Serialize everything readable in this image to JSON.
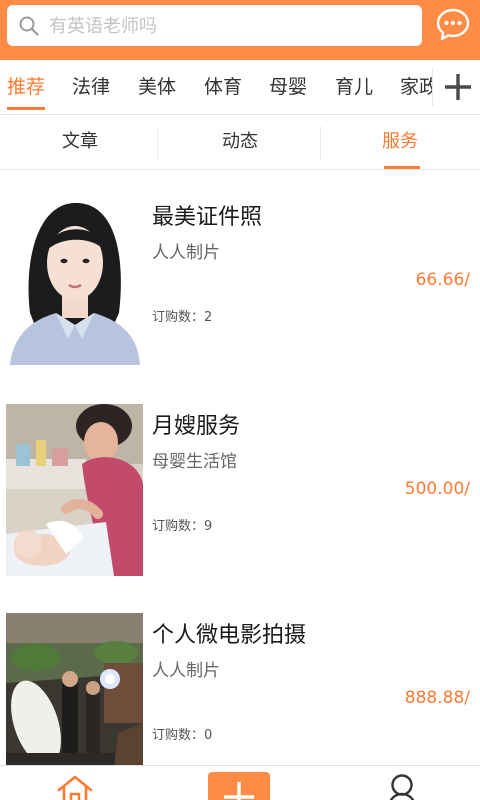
{
  "search": {
    "placeholder": "有英语老师吗"
  },
  "categories": [
    {
      "label": "推荐",
      "active": true
    },
    {
      "label": "法律",
      "active": false
    },
    {
      "label": "美体",
      "active": false
    },
    {
      "label": "体育",
      "active": false
    },
    {
      "label": "母婴",
      "active": false
    },
    {
      "label": "育儿",
      "active": false
    },
    {
      "label": "家政",
      "active": false
    }
  ],
  "sub_tabs": [
    {
      "label": "文章",
      "active": false
    },
    {
      "label": "动态",
      "active": false
    },
    {
      "label": "服务",
      "active": true
    }
  ],
  "services": [
    {
      "title": "最美证件照",
      "seller": "人人制片",
      "price": "66.66/",
      "orders": "订购数：2"
    },
    {
      "title": "月嫂服务",
      "seller": "母婴生活馆",
      "price": "500.00/",
      "orders": "订购数：9"
    },
    {
      "title": "个人微电影拍摄",
      "seller": "人人制片",
      "price": "888.88/",
      "orders": "订购数：0"
    }
  ],
  "colors": {
    "accent": "#ff7a33",
    "header": "#ff8c45"
  },
  "icons": {
    "search": "search-icon",
    "chat": "chat-bubble-icon",
    "add": "plus-icon",
    "home": "home-icon",
    "publish": "plus-icon",
    "user": "user-icon"
  }
}
